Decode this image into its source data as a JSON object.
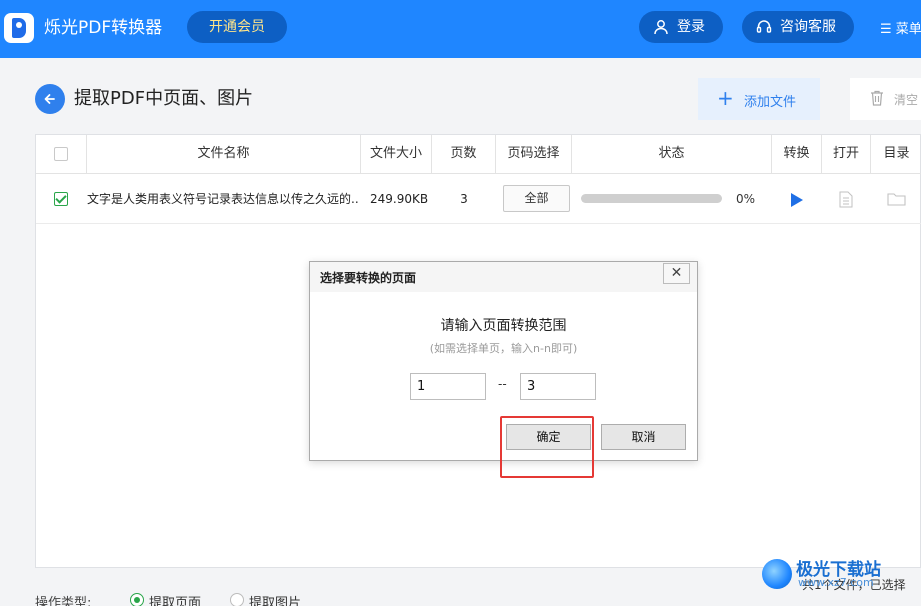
{
  "app": {
    "title": "烁光PDF转换器",
    "vip_label": "开通会员",
    "login_label": "登录",
    "support_label": "咨询客服",
    "menu_label": "菜单"
  },
  "page": {
    "title": "提取PDF中页面、图片",
    "add_file_label": "添加文件",
    "clear_label": "清空"
  },
  "table": {
    "headers": [
      "文件名称",
      "文件大小",
      "页数",
      "页码选择",
      "状态",
      "转换",
      "打开",
      "目录"
    ],
    "rows": [
      {
        "checked": true,
        "name": "文字是人类用表义符号记录表达信息以传之久远的...",
        "size": "249.90KB",
        "pages": "3",
        "range": "全部",
        "progress": 0,
        "progress_label": "0%"
      }
    ]
  },
  "dialog": {
    "title": "选择要转换的页面",
    "close_glyph": "✕",
    "prompt": "请输入页面转换范围",
    "hint": "(如需选择单页，输入n-n即可)",
    "from_value": "1",
    "separator": "--",
    "to_value": "3",
    "ok_label": "确定",
    "cancel_label": "取消"
  },
  "bottom": {
    "op_type_label": "操作类型:",
    "options": [
      {
        "label": "提取页面",
        "selected": true
      },
      {
        "label": "提取图片",
        "selected": false
      }
    ],
    "status": "共1个文件，已选择"
  },
  "watermark": {
    "name": "极光下载站",
    "url": "www.xz7.com"
  },
  "colors": {
    "primary": "#1f86ff",
    "accent": "#2f80ed",
    "check": "#2aa54a",
    "highlight": "#e53935",
    "vip_text": "#ffe58a"
  },
  "icons": [
    "logo-icon",
    "user-icon",
    "headset-icon",
    "menu-icon",
    "back-arrow-icon",
    "plus-icon",
    "trash-icon",
    "play-icon",
    "document-icon",
    "folder-icon",
    "close-icon"
  ]
}
